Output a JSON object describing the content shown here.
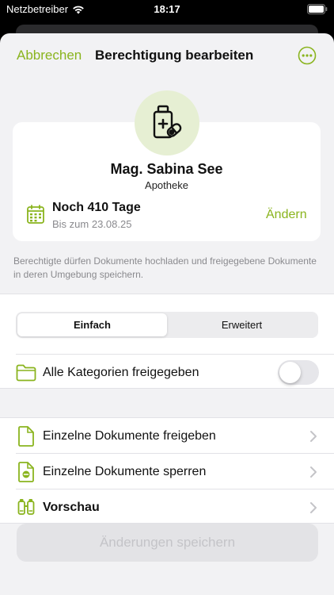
{
  "status_bar": {
    "carrier": "Netzbetreiber",
    "time": "18:17"
  },
  "nav": {
    "cancel_label": "Abbrechen",
    "title": "Berechtigung bearbeiten",
    "more_icon": "ellipsis-circle-icon"
  },
  "profile": {
    "icon": "pharmacy-bottle-icon",
    "name": "Mag. Sabina See",
    "role": "Apotheke",
    "validity_main": "Noch 410 Tage",
    "validity_sub": "Bis zum 23.08.25",
    "change_label": "Ändern"
  },
  "info_text": "Berechtigte dürfen Dokumente hochladen und freigegebene Dokumente in deren Umgebung speichern.",
  "segmented": {
    "options": [
      "Einfach",
      "Erweitert"
    ],
    "selected": "Einfach"
  },
  "categories_toggle": {
    "label": "Alle Kategorien freigegeben",
    "on": false
  },
  "list": [
    {
      "label": "Einzelne Dokumente freigeben",
      "icon": "document-icon",
      "bold": false
    },
    {
      "label": "Einzelne Dokumente sperren",
      "icon": "document-blocked-icon",
      "bold": false
    },
    {
      "label": "Vorschau",
      "icon": "binoculars-icon",
      "bold": true
    }
  ],
  "save_label": "Änderungen speichern",
  "colors": {
    "accent": "#8ab41e",
    "avatar_bg": "#e6efd3",
    "sheet_bg": "#f2f2f4"
  }
}
